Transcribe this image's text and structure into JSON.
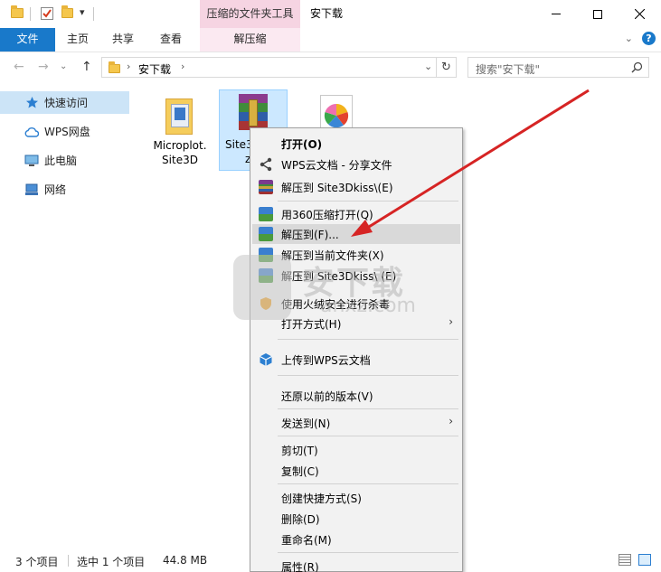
{
  "titlebar": {
    "context_tab": "压缩的文件夹工具",
    "title": "安下载",
    "qat_dropdown": "▾"
  },
  "ribbon": {
    "tabs": [
      "文件",
      "主页",
      "共享",
      "查看",
      "解压缩"
    ]
  },
  "address": {
    "path_item": "安下载",
    "search_placeholder": "搜索\"安下载\""
  },
  "sidebar": {
    "items": [
      {
        "label": "快速访问",
        "icon": "star-icon"
      },
      {
        "label": "WPS网盘",
        "icon": "cloud-icon"
      },
      {
        "label": "此电脑",
        "icon": "computer-icon"
      },
      {
        "label": "网络",
        "icon": "network-icon"
      }
    ]
  },
  "files": [
    {
      "line1": "Microplot.",
      "line2": "Site3D",
      "icon": "folder-icon"
    },
    {
      "line1": "Site3",
      "line2": "z",
      "icon": "rar-archive-icon"
    },
    {
      "line1": "",
      "line2": "",
      "icon": "image-file-icon"
    }
  ],
  "status": {
    "count": "3 个项目",
    "selected": "选中 1 个项目",
    "size": "44.8 MB"
  },
  "context_menu": {
    "items": [
      {
        "label": "打开(O)",
        "icon": "",
        "bold": true,
        "sub": false
      },
      {
        "label": "WPS云文档 - 分享文件",
        "icon": "share-icon",
        "sub": false
      },
      {
        "label": "解压到 Site3Dkiss\\(E)",
        "icon": "rar-icon",
        "sub": false
      },
      {
        "label": "用360压缩打开(Q)",
        "icon": "zip360-icon",
        "sub": false
      },
      {
        "label": "解压到(F)...",
        "icon": "zip360-icon",
        "sub": false,
        "highlight": true
      },
      {
        "label": "解压到当前文件夹(X)",
        "icon": "zip360-icon",
        "sub": false
      },
      {
        "label": "解压到 Site3Dkiss\\ (E)",
        "icon": "zip360-icon",
        "sub": false
      },
      {
        "label": "使用火绒安全进行杀毒",
        "icon": "shield-icon",
        "sub": false
      },
      {
        "label": "打开方式(H)",
        "icon": "",
        "sub": true
      },
      {
        "label": "上传到WPS云文档",
        "icon": "upload-cube-icon",
        "sub": false
      },
      {
        "label": "还原以前的版本(V)",
        "icon": "",
        "sub": false
      },
      {
        "label": "发送到(N)",
        "icon": "",
        "sub": true
      },
      {
        "label": "剪切(T)",
        "icon": "",
        "sub": false
      },
      {
        "label": "复制(C)",
        "icon": "",
        "sub": false
      },
      {
        "label": "创建快捷方式(S)",
        "icon": "",
        "sub": false
      },
      {
        "label": "删除(D)",
        "icon": "",
        "sub": false
      },
      {
        "label": "重命名(M)",
        "icon": "",
        "sub": false
      },
      {
        "label": "属性(R)",
        "icon": "",
        "sub": false
      }
    ]
  },
  "watermark": {
    "text": "安下载",
    "sub": "anxz.com"
  },
  "colors": {
    "accent": "#1979ca",
    "context_tab": "#f6d4e2",
    "selection": "#cce4f7",
    "arrow": "#d62424"
  }
}
